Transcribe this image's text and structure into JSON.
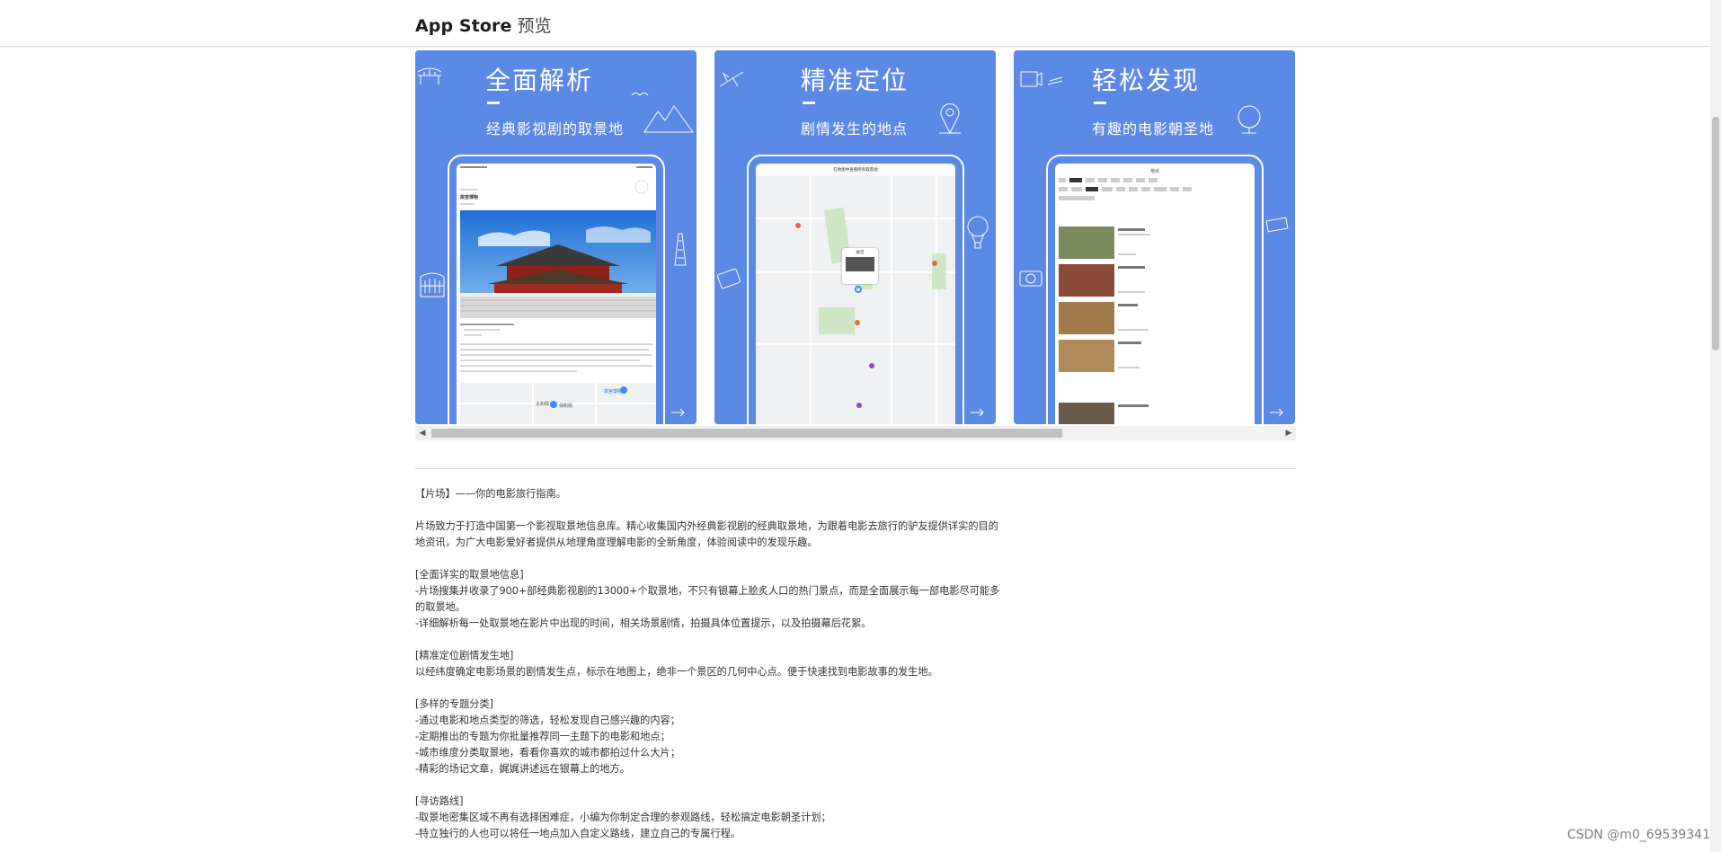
{
  "header": {
    "title": "App Store",
    "subtitle": "预览"
  },
  "screenshots": [
    {
      "heading": "全面解析",
      "subtitle": "经典影视剧的取景地",
      "screen": {
        "place_title": "故宫博物",
        "map_labels": [
          "故宫博物",
          "太和殿",
          "保和殿"
        ],
        "icons": [
          "bridge-icon",
          "mountains-icon",
          "tower-icon",
          "clapperboard-icon",
          "arrow-right-icon"
        ]
      }
    },
    {
      "heading": "精准定位",
      "subtitle": "剧情发生的地点",
      "screen": {
        "place_title": "在地图中查看所有取景地",
        "popup_label": "故宫",
        "icons": [
          "plane-icon",
          "location-pin-icon",
          "balloon-icon",
          "arrow-right-icon"
        ]
      }
    },
    {
      "heading": "轻松发现",
      "subtitle": "有趣的电影朝圣地",
      "screen": {
        "place_title": "地点",
        "icons": [
          "film-reel-icon",
          "globe-icon",
          "camera-icon",
          "arrow-right-icon"
        ]
      }
    }
  ],
  "description": [
    "【片场】——你的电影旅行指南。",
    "",
    "片场致力于打造中国第一个影视取景地信息库。精心收集国内外经典影视剧的经典取景地，为跟着电影去旅行的驴友提供详实的目的地资讯，为广大电影爱好者提供从地理角度理解电影的全新角度，体验阅读中的发现乐趣。",
    "",
    "[全面详实的取景地信息]",
    "-片场搜集并收录了900+部经典影视剧的13000+个取景地，不只有银幕上脍炙人口的热门景点，而是全面展示每一部电影尽可能多的取景地。",
    "-详细解析每一处取景地在影片中出现的时间，相关场景剧情，拍摄具体位置提示，以及拍摄幕后花絮。",
    "",
    "[精准定位剧情发生地]",
    "以经纬度确定电影场景的剧情发生点，标示在地图上，绝非一个景区的几何中心点。便于快速找到电影故事的发生地。",
    "",
    "[多样的专题分类]",
    "-通过电影和地点类型的筛选，轻松发现自己感兴趣的内容；",
    "-定期推出的专题为你批量推荐同一主题下的电影和地点；",
    "-城市维度分类取景地，看看你喜欢的城市都拍过什么大片；",
    "-精彩的场记文章，娓娓讲述远在银幕上的地方。",
    "",
    "[寻访路线]",
    "-取景地密集区域不再有选择困难症，小编为你制定合理的参观路线，轻松搞定电影朝圣计划；",
    "-特立独行的人也可以将任一地点加入自定义路线，建立自己的专属行程。"
  ],
  "watermark": "CSDN @m0_69539341",
  "colors": {
    "screenshot_bg": "#5b89e6",
    "header_border": "#d9d9d9",
    "text": "#333333"
  }
}
